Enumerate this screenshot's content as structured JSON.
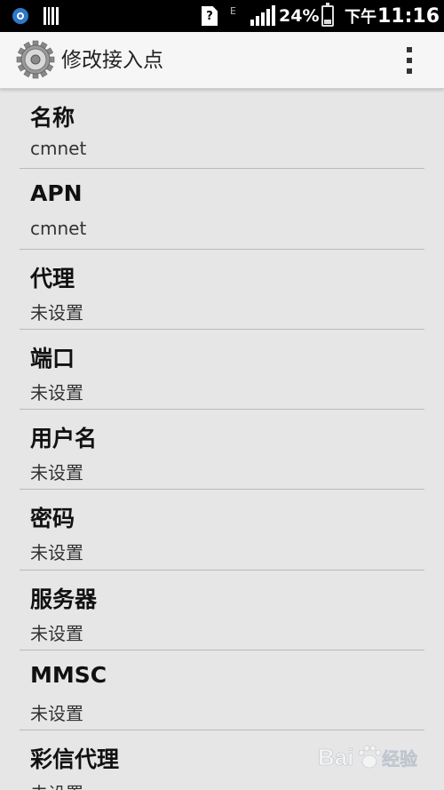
{
  "status_bar": {
    "battery_percent": "24%",
    "time_period": "下午",
    "time": "11:16",
    "sim_label": "?",
    "network_type": "E",
    "signal_level": 4,
    "battery_level": 0.24
  },
  "action_bar": {
    "title": "修改接入点",
    "icon": "settings-gear-icon",
    "menu_icon": "overflow-menu-icon"
  },
  "apn_fields": [
    {
      "label": "名称",
      "value": "cmnet"
    },
    {
      "label": "APN",
      "value": "cmnet"
    },
    {
      "label": "代理",
      "value": "未设置"
    },
    {
      "label": "端口",
      "value": "未设置"
    },
    {
      "label": "用户名",
      "value": "未设置"
    },
    {
      "label": "密码",
      "value": "未设置"
    },
    {
      "label": "服务器",
      "value": "未设置"
    },
    {
      "label": "MMSC",
      "value": "未设置"
    },
    {
      "label": "彩信代理",
      "value": "未设置"
    }
  ],
  "watermark": {
    "text": "Bai经验",
    "colors": {
      "primary": "#ffffff",
      "accent": "#2f77c8"
    }
  }
}
